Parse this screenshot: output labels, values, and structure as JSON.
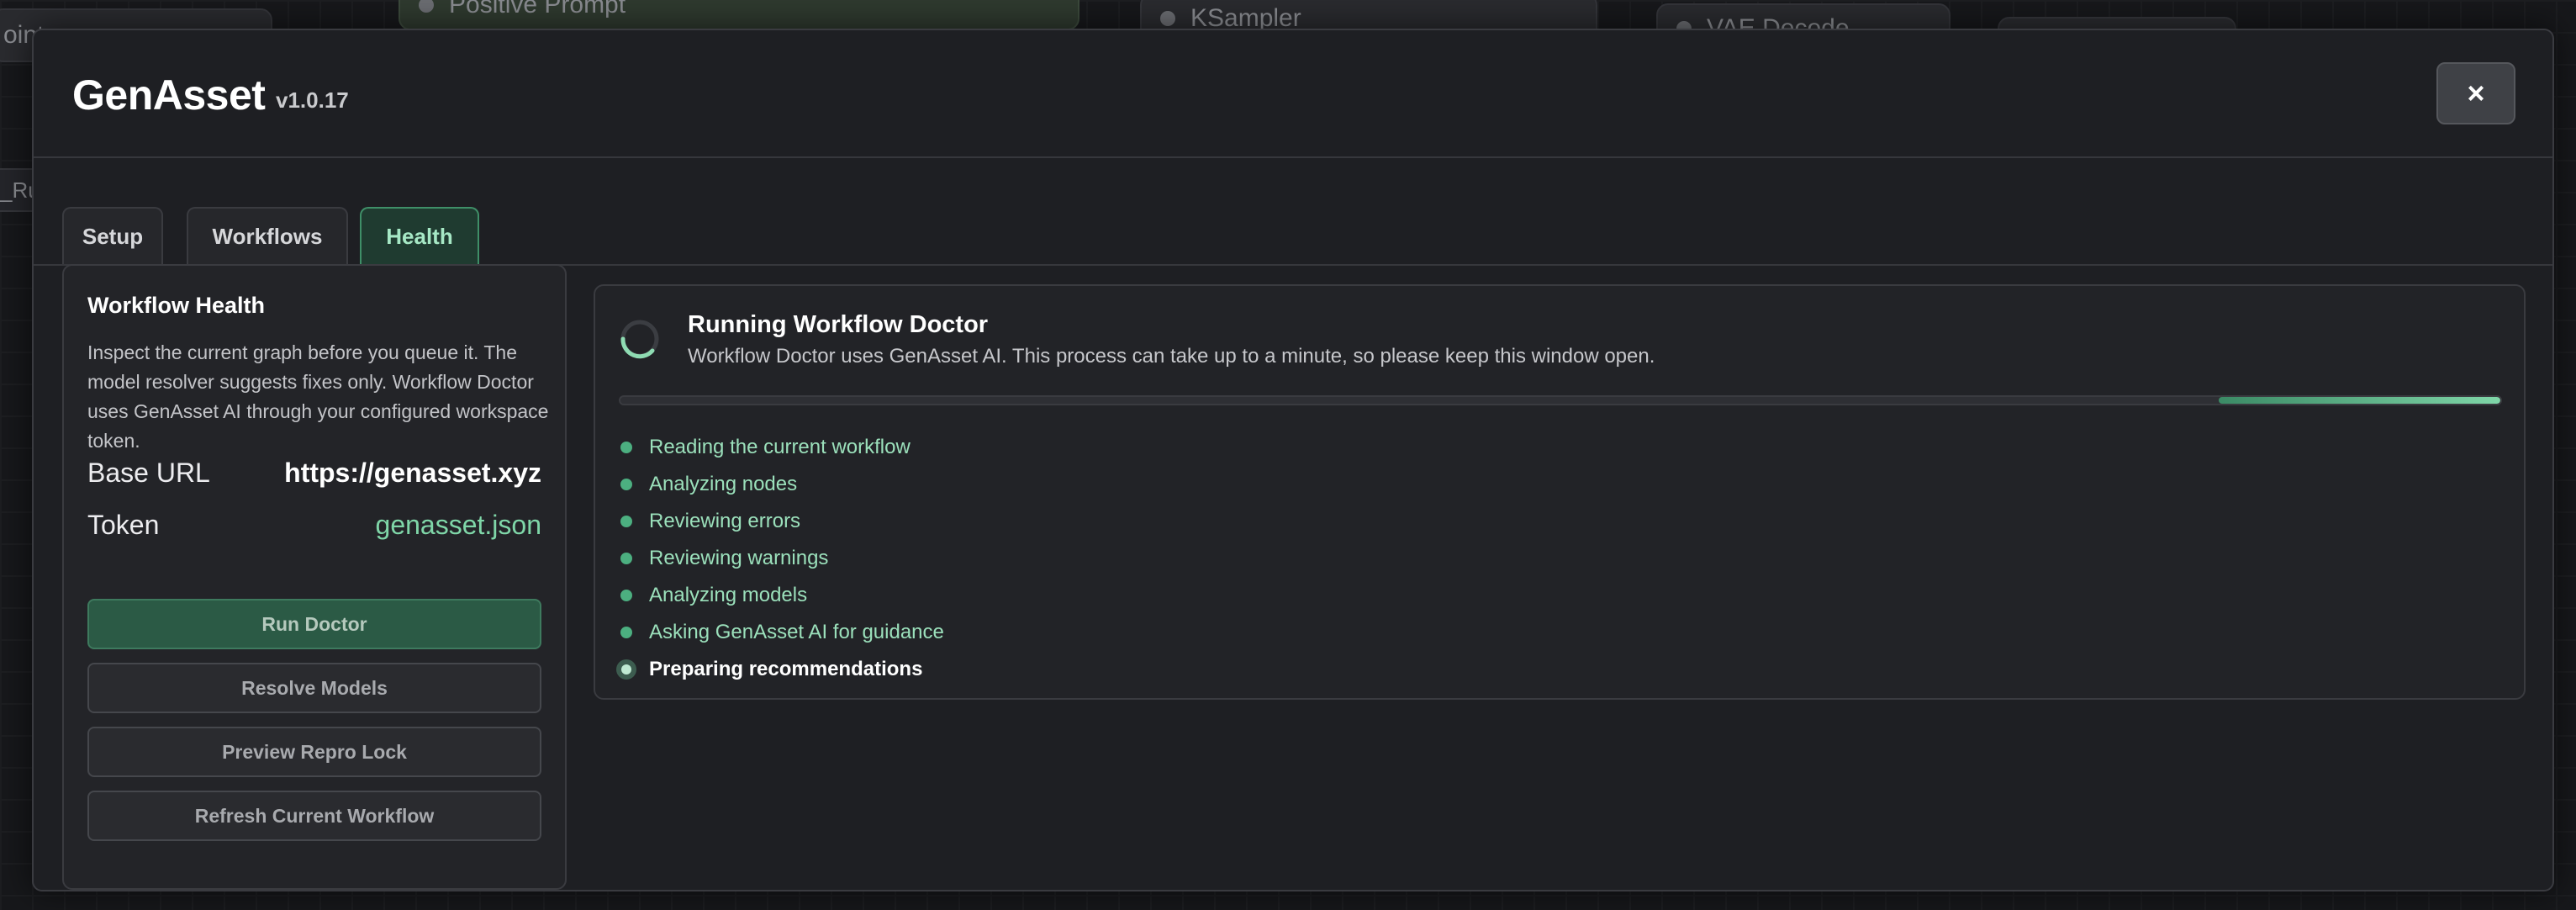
{
  "background": {
    "left_node_label": "oint",
    "left_run_label": "_Ru",
    "node_positive_prompt": "Positive Prompt",
    "node_ksampler": "KSampler",
    "node_vae_decode": "VAE Decode"
  },
  "header": {
    "title": "GenAsset",
    "version": "v1.0.17",
    "close_label": "×"
  },
  "tabs": [
    {
      "label": "Setup",
      "active": false
    },
    {
      "label": "Workflows",
      "active": false
    },
    {
      "label": "Health",
      "active": true
    }
  ],
  "left_panel": {
    "title": "Workflow Health",
    "description": "Inspect the current graph before you queue it. The model resolver suggests fixes only. Workflow Doctor uses GenAsset AI through your configured workspace token.",
    "base_url_label": "Base URL",
    "base_url_value": "https://genasset.xyz",
    "token_label": "Token",
    "token_value": "genasset.json",
    "buttons": {
      "run_doctor": "Run Doctor",
      "resolve_models": "Resolve Models",
      "preview_repro_lock": "Preview Repro Lock",
      "refresh_current_workflow": "Refresh Current Workflow"
    }
  },
  "right_panel": {
    "title": "Running Workflow Doctor",
    "subtitle": "Workflow Doctor uses GenAsset AI. This process can take up to a minute, so please keep this window open.",
    "progress_fraction": 0.15,
    "steps": [
      {
        "label": "Reading the current workflow",
        "state": "done"
      },
      {
        "label": "Analyzing nodes",
        "state": "done"
      },
      {
        "label": "Reviewing errors",
        "state": "done"
      },
      {
        "label": "Reviewing warnings",
        "state": "done"
      },
      {
        "label": "Analyzing models",
        "state": "done"
      },
      {
        "label": "Asking GenAsset AI for guidance",
        "state": "done"
      },
      {
        "label": "Preparing recommendations",
        "state": "active"
      }
    ]
  },
  "colors": {
    "accent": "#7fd6a8",
    "tab_active_bg": "#1f3b30",
    "run_button_bg": "#2b5a45",
    "step_done": "#4caf80"
  }
}
